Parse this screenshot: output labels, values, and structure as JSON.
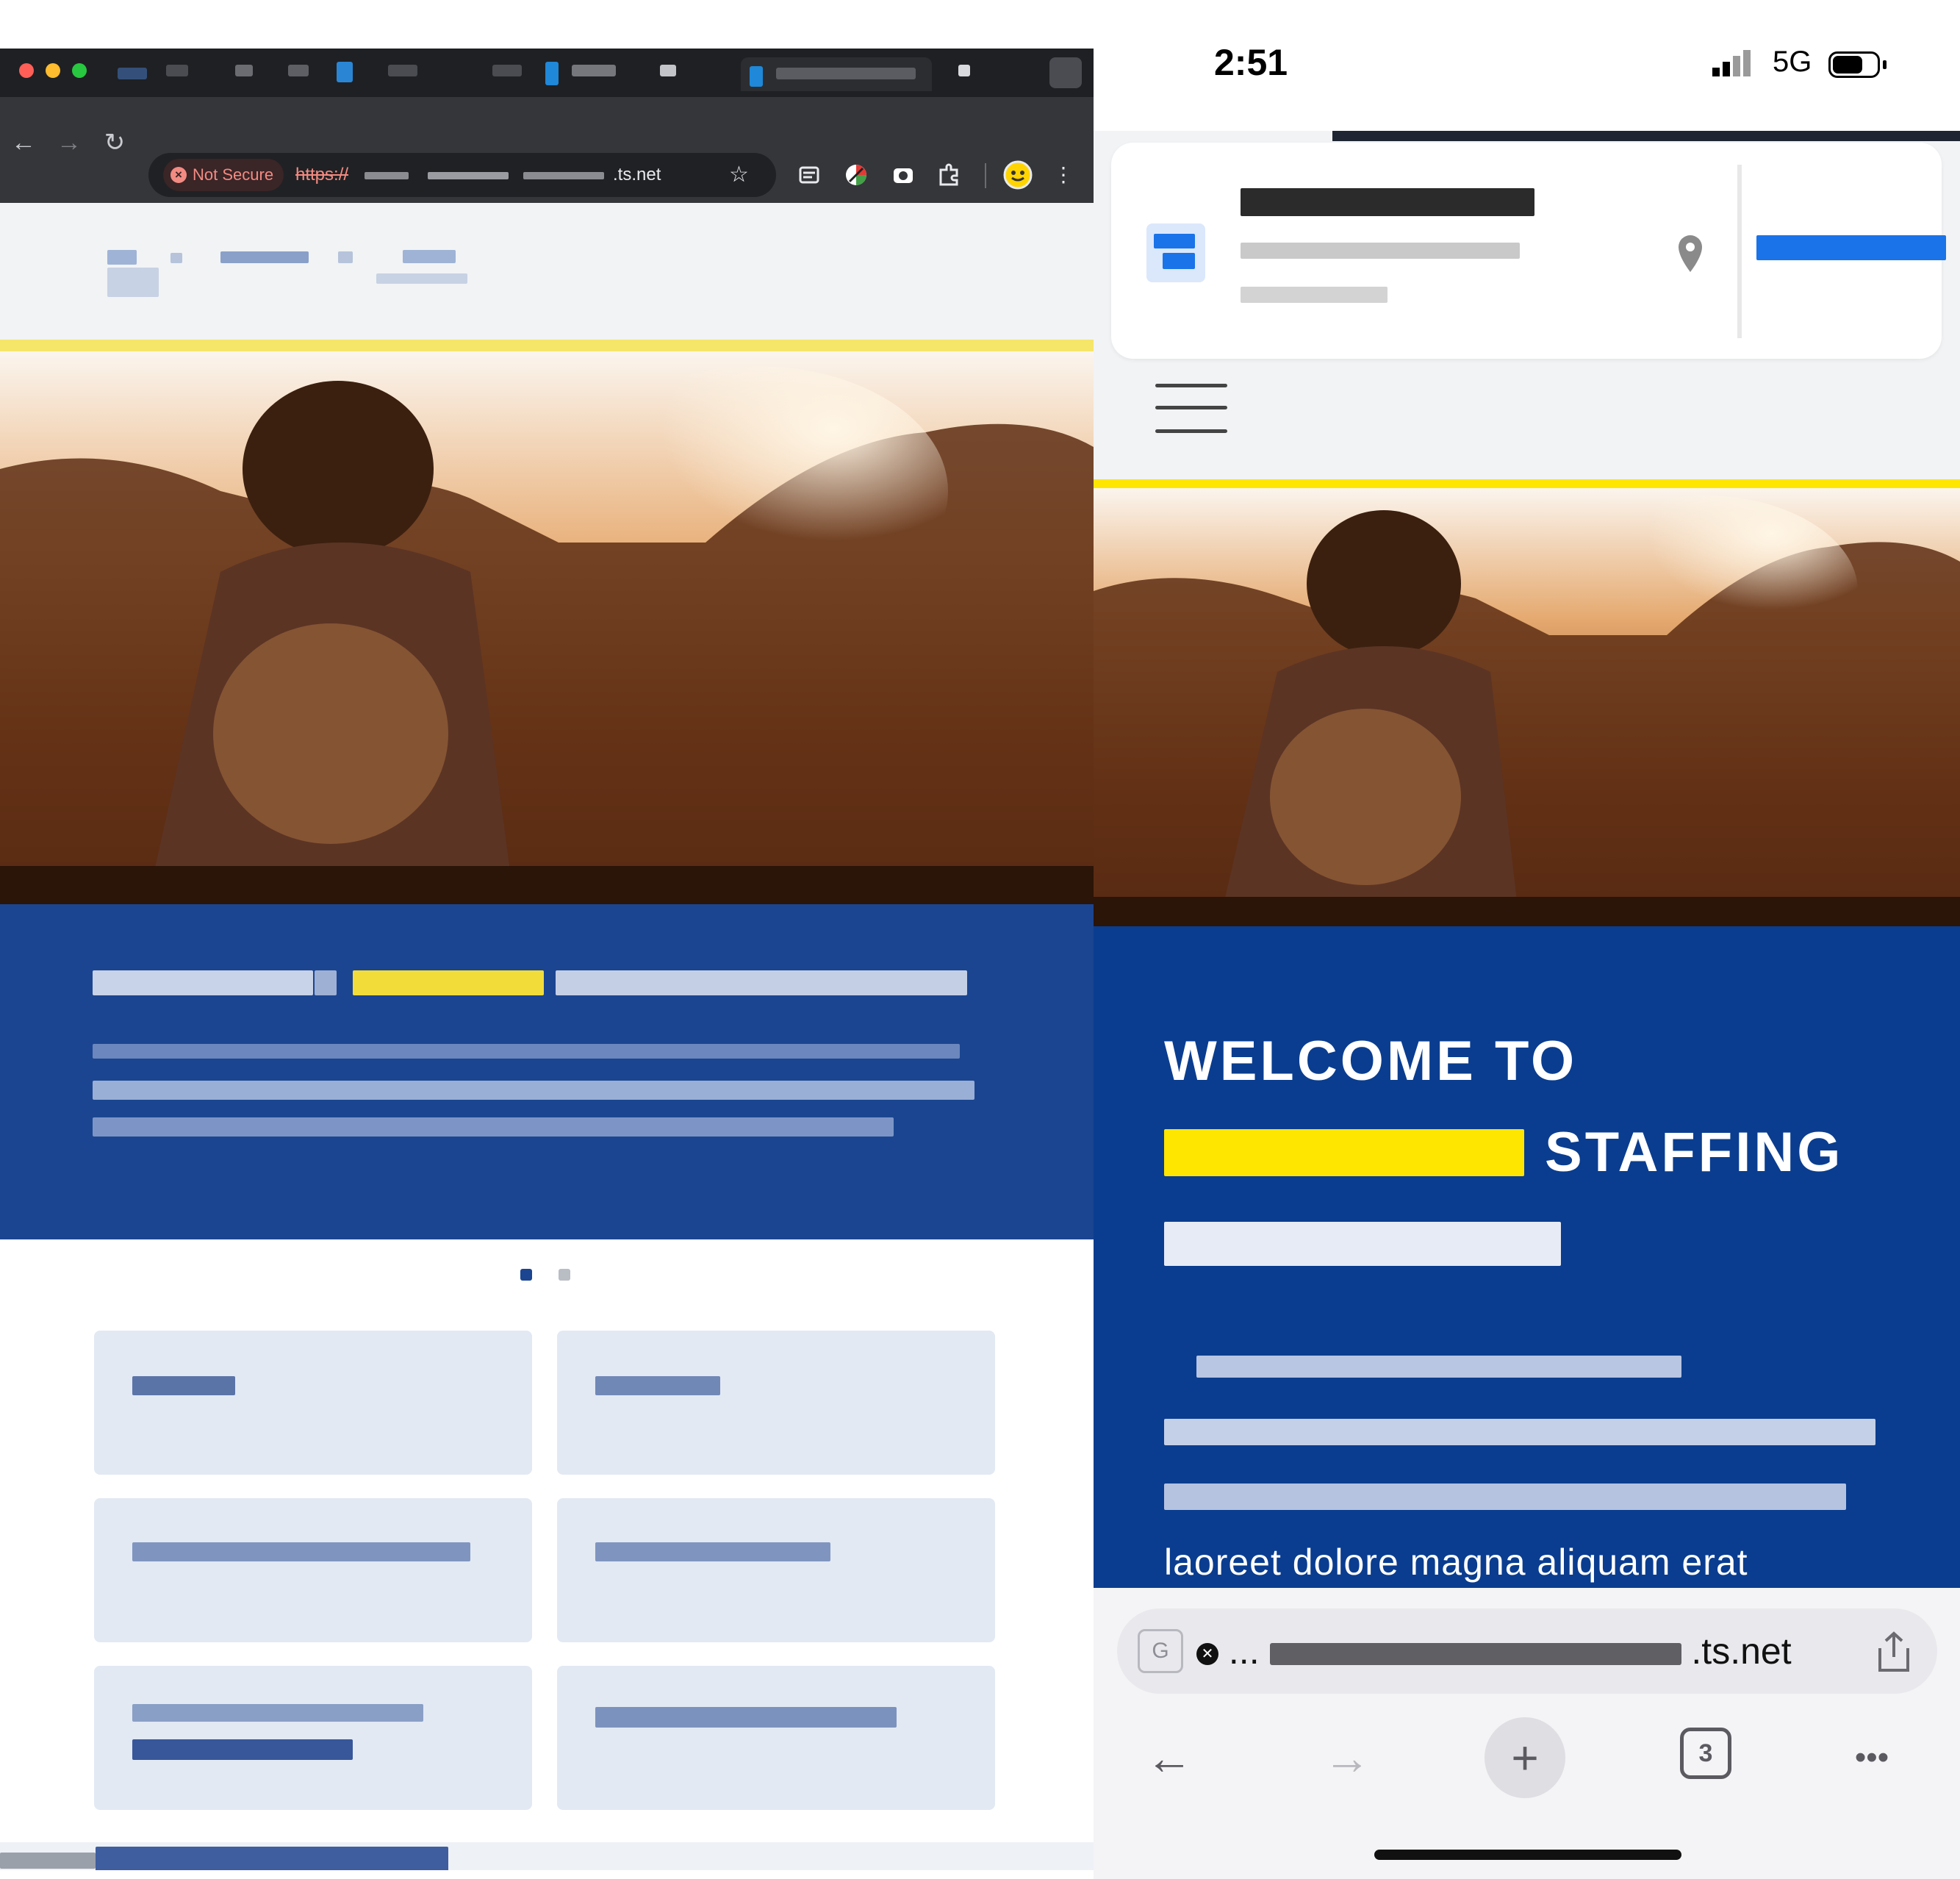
{
  "desktop": {
    "chrome": {
      "colors": {
        "titlebar": "#1f2023",
        "toolbar": "#35363a"
      },
      "traffic_lights": [
        "#ff5f57",
        "#febc2e",
        "#28c840"
      ],
      "nav": {
        "back": "←",
        "forward": "→",
        "reload": "↻"
      },
      "security_badge": "Not Secure",
      "url_scheme": "https://",
      "url_host_visible": ".ts.net",
      "bookmark_icon": "☆",
      "extensions": [
        "extension-list-icon",
        "color-extension-icon",
        "camera-extension-icon",
        "puzzle-extension-icon"
      ],
      "profile_icon": "smiley-avatar-icon",
      "menu_icon": "⋮"
    },
    "site": {
      "accent_yellow": "#f5e66a",
      "welcome_bg": "#1b4590",
      "carousel_dots": 2,
      "carousel_active": 0,
      "cards": [
        {
          "title": ""
        },
        {
          "title": ""
        },
        {
          "title": ""
        },
        {
          "title": ""
        },
        {
          "title": ""
        },
        {
          "title": ""
        }
      ]
    }
  },
  "mobile": {
    "status": {
      "time": "2:51",
      "network": "5G"
    },
    "header_card": {
      "brand_color": "#1a73e8"
    },
    "menu_icon": "hamburger-icon",
    "accent_yellow": "#ffe600",
    "welcome": {
      "bg": "#0a3d8f",
      "line1": "WELCOME TO",
      "line2_highlight": "",
      "line2_rest": "STAFFING",
      "line3": "",
      "para_last": "laoreet dolore magna aliquam erat"
    },
    "address_bar": {
      "translate_icon": "G",
      "close_icon": "✕",
      "url_prefix": "...",
      "url_suffix": ".ts.net",
      "share_icon": "share-icon"
    },
    "bottom_nav": {
      "back": "←",
      "forward": "→",
      "add": "+",
      "tabs_count": "3",
      "more": "•••"
    }
  }
}
